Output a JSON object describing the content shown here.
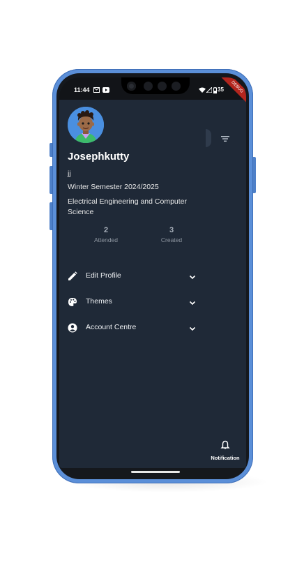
{
  "status_bar": {
    "time": "11:44",
    "battery": "35"
  },
  "debug_banner": "DEBUG",
  "profile": {
    "name": "Josephkutty",
    "handle": "jj",
    "semester": "Winter Semester 2024/2025",
    "department": "Electrical Engineering and Computer Science"
  },
  "stats": [
    {
      "value": "2",
      "label": "Attended"
    },
    {
      "value": "3",
      "label": "Created"
    }
  ],
  "menu": [
    {
      "label": "Edit Profile",
      "icon": "pencil-icon"
    },
    {
      "label": "Themes",
      "icon": "palette-icon"
    },
    {
      "label": "Account Centre",
      "icon": "account-circle-icon"
    }
  ],
  "notification": {
    "label": "Notification",
    "icon": "bell-icon"
  },
  "colors": {
    "phone_frame": "#5b8fd8",
    "screen_bg": "#1f2937",
    "avatar_bg": "#4a8fe0"
  }
}
